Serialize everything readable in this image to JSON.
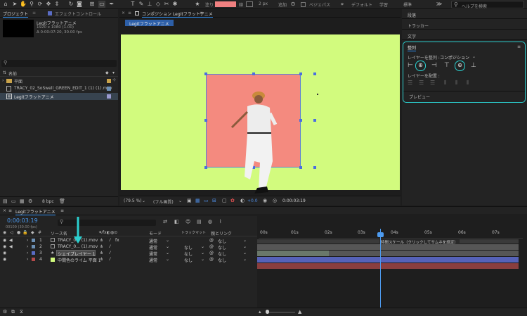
{
  "toolbar": {
    "fill_label": "塗り",
    "stroke_label": "線",
    "stroke_width": "2 px",
    "add_label": "追加",
    "bezier_label": "ベジェパス",
    "workspace_default": "デフォルト",
    "workspace_learn": "学習",
    "workspace_standard": "標準",
    "search_placeholder": "ヘルプを検索",
    "fill_color": "#f08080"
  },
  "project": {
    "tab_label": "プロジェクト",
    "effects_tab_label": "エフェクトコントロール",
    "preview_name": "Legitフラットアニメ",
    "preview_size": "1920 x 1080 (1.00)",
    "preview_duration": "Δ 0:00:07:20, 30.00 fps",
    "name_col": "名前",
    "items": [
      {
        "name": "平面"
      },
      {
        "name": "TRACY_02_SoSwell_GREEN_EDIT_1 (1) (1).mov"
      },
      {
        "name": "Legitフラットアニメ"
      }
    ],
    "bpc": "8 bpc"
  },
  "comp": {
    "tab_label": "コンポジション",
    "comp_name": "Legitフラットアニメ",
    "breadcrumb": "Legitフラットアニメ",
    "zoom": "(79.5 %)",
    "quality": "(フル画質)",
    "exposure": "+0.0",
    "timecode": "0:00:03:19",
    "bg_color": "#d2fb7e",
    "rect_color": "#f48a7f"
  },
  "right": {
    "panels": [
      "段落",
      "トラッカー",
      "文字"
    ],
    "align_title": "整列",
    "align_layers_to": "レイヤーを整列 :",
    "align_target": "コンポジション",
    "distribute_label": "レイヤーを配置 :",
    "preview_label": "プレビュー"
  },
  "timeline": {
    "comp_tab": "Legitフラットアニメ",
    "timecode": "0:00:03:19",
    "frames": "00109 (30.00 fps)",
    "col_source": "ソース名",
    "col_mode": "モード",
    "col_trkmat": "トラックマット",
    "col_parent": "親とリンク",
    "time_marks": [
      "00s",
      "01s",
      "02s",
      "03s",
      "04s",
      "05s",
      "06s",
      "07s"
    ],
    "tooltip": "時間スケール（クリックしてサムネを設定）",
    "layers": [
      {
        "num": "1",
        "name": "TRACY_0... (1).mov",
        "mode": "通常",
        "trkmat": "",
        "parent": "なし",
        "color": "#6c8fb3"
      },
      {
        "num": "2",
        "name": "TRACY_0... (1).mov",
        "mode": "通常",
        "trkmat": "なし",
        "parent": "なし",
        "color": "#6c8fb3"
      },
      {
        "num": "3",
        "name": "シェイプレイヤー 1",
        "mode": "通常",
        "trkmat": "なし",
        "parent": "なし",
        "color": "#5a6cc4"
      },
      {
        "num": "4",
        "name": "中間色のライム 平面 1",
        "mode": "通常",
        "trkmat": "なし",
        "parent": "なし",
        "color": "#b44a4a"
      }
    ]
  }
}
